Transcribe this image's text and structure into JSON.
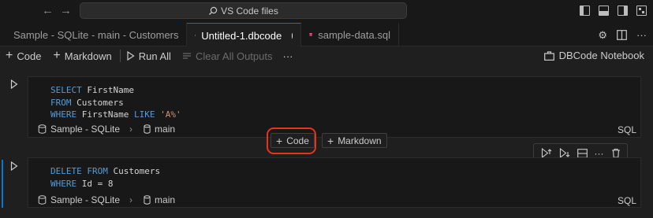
{
  "titlebar": {
    "search_text": "VS Code files",
    "back_glyph": "←",
    "forward_glyph": "→"
  },
  "tabs": [
    {
      "label": "Sample - SQLite - main - Customers",
      "icon": "table-icon",
      "active": false
    },
    {
      "label": "Untitled-1.dbcode",
      "icon": "notebook-icon",
      "active": true,
      "dirty": true
    },
    {
      "label": "sample-data.sql",
      "icon": "database-icon",
      "active": false
    }
  ],
  "toolbar": {
    "add_code": "Code",
    "add_markdown": "Markdown",
    "run_all": "Run All",
    "clear_outputs": "Clear All Outputs",
    "more": "···",
    "kernel": "DBCode Notebook"
  },
  "cells": [
    {
      "lines": [
        "SELECT FirstName",
        "FROM Customers",
        "WHERE FirstName LIKE 'A%'"
      ],
      "connection": "Sample - SQLite",
      "schema": "main",
      "language": "SQL"
    },
    {
      "lines": [
        "DELETE FROM Customers",
        "WHERE Id = 8"
      ],
      "connection": "Sample - SQLite",
      "schema": "main",
      "language": "SQL"
    }
  ],
  "insert_bar": {
    "code": "Code",
    "markdown": "Markdown"
  },
  "colors": {
    "accent": "#0078d4",
    "highlight": "#e5331e",
    "keyword": "#569cd6",
    "string": "#ce9178"
  }
}
